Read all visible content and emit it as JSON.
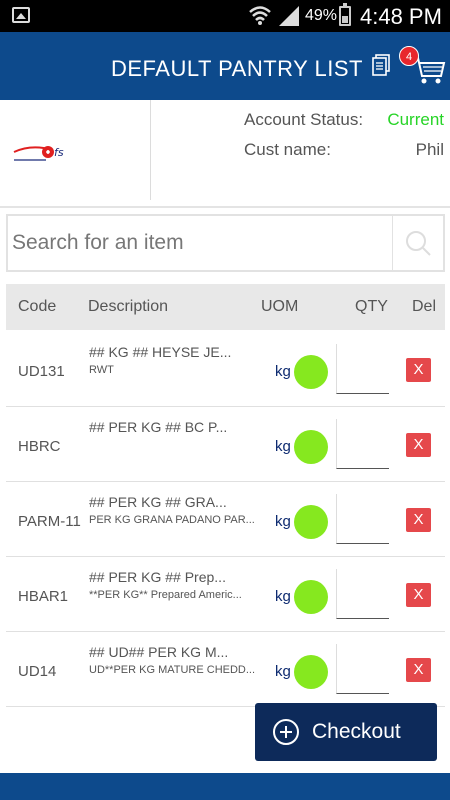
{
  "status_bar": {
    "battery": "49%",
    "time": "4:48 PM"
  },
  "header": {
    "title": "DEFAULT PANTRY LIST",
    "cart_badge": "4"
  },
  "account": {
    "status_label": "Account Status:",
    "status_value": "Current",
    "cust_label": "Cust name:",
    "cust_value": "Phil"
  },
  "search": {
    "placeholder": "Search for an item"
  },
  "table": {
    "headers": {
      "code": "Code",
      "description": "Description",
      "uom": "UOM",
      "qty": "QTY",
      "del": "Del"
    },
    "rows": [
      {
        "code": "UD131",
        "desc1": "## KG ## HEYSE JE...",
        "desc2": "RWT",
        "uom": "kg",
        "del": "X"
      },
      {
        "code": "HBRC",
        "desc1": "## PER KG ## BC P...",
        "desc2": "",
        "uom": "kg",
        "del": "X"
      },
      {
        "code": "PARM-11",
        "desc1": "## PER KG ## GRA...",
        "desc2": "PER KG GRANA PADANO PAR...",
        "uom": "kg",
        "del": "X"
      },
      {
        "code": "HBAR1",
        "desc1": "## PER KG ## Prep...",
        "desc2": "**PER KG** Prepared  Americ...",
        "uom": "kg",
        "del": "X"
      },
      {
        "code": "UD14",
        "desc1": "## UD## PER KG M...",
        "desc2": "UD**PER KG MATURE CHEDD...",
        "uom": "kg",
        "del": "X"
      }
    ]
  },
  "checkout": {
    "label": "Checkout"
  },
  "colors": {
    "primary": "#0d4a8c",
    "checkout_bg": "#0d2a5a",
    "status_current": "#27d427",
    "uom_indicator": "#86e81f",
    "delete": "#e5484b",
    "badge": "#e8262c"
  }
}
